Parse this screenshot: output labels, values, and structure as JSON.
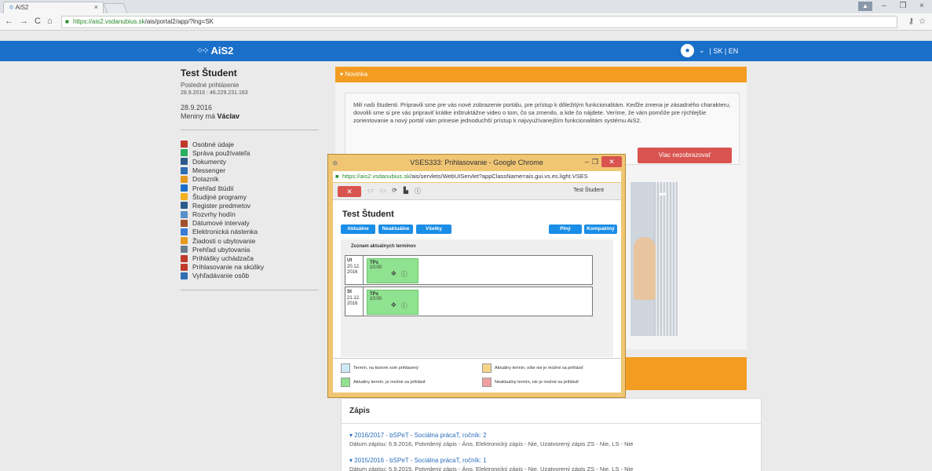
{
  "browser": {
    "tab_title": "AiS2",
    "tab_close": "×",
    "url_scheme": "https://",
    "url_host": "ais2.vsdanubius.sk",
    "url_path": "/ais/portal2/app/?lng=SK",
    "win_user": "▲",
    "win_min": "–",
    "win_max": "❐",
    "win_close": "×"
  },
  "header": {
    "logo": "AiS2",
    "lang": "| SK | EN"
  },
  "user": {
    "name": "Test Študent",
    "last_login_label": "Posledné prihlásenie",
    "last_login_value": "28.9.2016 : 46.229.231.163",
    "date": "28.9.2016",
    "nameday_prefix": "Meniny má ",
    "nameday_name": "Václav"
  },
  "menu": [
    {
      "label": "Osobné údaje",
      "color": "#c0392b"
    },
    {
      "label": "Správa používateľa",
      "color": "#27ae60"
    },
    {
      "label": "Dokumenty",
      "color": "#2c5a8a"
    },
    {
      "label": "Messenger",
      "color": "#2f6db3"
    },
    {
      "label": "Dotazník",
      "color": "#e59a1e"
    },
    {
      "label": "Prehľad štúdií",
      "color": "#1a6fc9"
    },
    {
      "label": "Študijné programy",
      "color": "#f2b01e"
    },
    {
      "label": "Register predmetov",
      "color": "#2c5a8a"
    },
    {
      "label": "Rozvrhy hodín",
      "color": "#5b8fc7"
    },
    {
      "label": "Dátumové intervaly",
      "color": "#a0522d"
    },
    {
      "label": "Elektronická nástenka",
      "color": "#3a7bd5"
    },
    {
      "label": "Žiadosti o ubytovanie",
      "color": "#e59a1e"
    },
    {
      "label": "Prehľad ubytovania",
      "color": "#6b7d8f"
    },
    {
      "label": "Prihlášky uchádzača",
      "color": "#c0392b"
    },
    {
      "label": "Prihlasovanie na skúšky",
      "color": "#c0392b"
    },
    {
      "label": "Vyhľadávanie osôb",
      "color": "#2f6db3"
    }
  ],
  "news": {
    "header": "▾ Novinka",
    "text": "Milí naši študenti. Pripravili sme pre vás nové zobrazenie portálu, pre prístup k dôležitým funkcionalitám. Keďže zmena je zásadného charakteru, dovolili sme si pre vás pripraviť krátke inštruktážne video o tom, čo sa zmenilo, a kde čo nájdete. Veríme, že vám pomôže pre rýchlejšie zorientovanie a nový portál vám prinesie jednoduchší prístup k najvyužívanejším funkcionalitám systému AiS2.",
    "button": "Viac nezobrazovať"
  },
  "popup": {
    "title": "VSES333: Prihlasovanie - Google Chrome",
    "url_scheme": "https://",
    "url_host": "ais2.vsdanubius.sk",
    "url_path": "/ais/servlets/WebUIServlet?appClassName=ais.gui.vs.es.light.VSES",
    "user": "Test Študent",
    "student": "Test Študent",
    "btn_current": "Aktuálne",
    "btn_not_current": "Neaktuálne",
    "btn_all": "Všetky",
    "btn_full": "Plný",
    "btn_compact": "Kompaktný",
    "list_title": "Zoznam aktuálnych termínov",
    "days": [
      {
        "day": "Ut",
        "date": "20.12.",
        "year": "2016",
        "slot_title": "TPs",
        "slot_time": "10:00"
      },
      {
        "day": "St",
        "date": "21.12.",
        "year": "2016",
        "slot_title": "TPs",
        "slot_time": "10:00"
      }
    ],
    "legend": [
      {
        "label": "Termín, na ktorom som prihlásený",
        "color": "#cfe8f7"
      },
      {
        "label": "Aktuálny termín, ešte nie je možné sa prihlásiť",
        "color": "#f6d58a"
      },
      {
        "label": "Aktuálny termín, je možné sa prihlásiť",
        "color": "#8fe28f"
      },
      {
        "label": "Neaktuálny termín, nie je možné sa prihlásiť",
        "color": "#f0a0a0"
      }
    ]
  },
  "zapis": {
    "title": "Zápis",
    "rows": [
      {
        "link": "▾ 2016/2017 - bSPeT - Sociálna prácaT, ročník: 2",
        "detail": "Dátum zápisu: 6.9.2016, Potvrdený zápis - Áno, Elektronický zápis - Nie, Uzatvorený zápis ZS - Nie, LS - Nie"
      },
      {
        "link": "▾ 2015/2016 - bSPeT - Sociálna prácaT, ročník: 1",
        "detail": "Dátum zápisu: 5.9.2015, Potvrdený zápis - Áno, Elektronický zápis - Nie, Uzatvorený zápis ZS - Nie, LS - Nie"
      }
    ]
  },
  "colors": {
    "header_blue": "#1a6fc9",
    "accent_orange": "#f39c22",
    "danger_red": "#d9534f",
    "slot_green": "#8fe28f",
    "button_blue": "#1a8de6"
  }
}
